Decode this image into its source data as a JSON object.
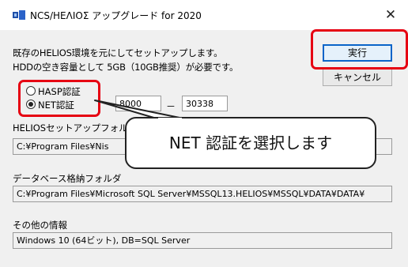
{
  "window": {
    "title": "NCS/HEΛIOΣ アップグレード for 2020",
    "close_glyph": "✕"
  },
  "description": {
    "line1": "既存のHELIOS環境を元にしてセットアップします。",
    "line2": "HDDの空き容量として 5GB（10GB推奨）が必要です。"
  },
  "buttons": {
    "execute": "実行",
    "cancel": "キャンセル"
  },
  "auth": {
    "hasp_label": "HASP認証",
    "net_label": "NET認証",
    "selected": "NET認証",
    "port_from": "8000",
    "port_separator": "－",
    "port_to": "30338"
  },
  "setup_folder": {
    "label": "HELIOSセットアップフォル",
    "value": "C:¥Program Files¥Nis"
  },
  "db_folder": {
    "label": "データベース格納フォルダ",
    "value": "C:¥Program Files¥Microsoft SQL Server¥MSSQL13.HELIOS¥MSSQL¥DATA¥DATA¥"
  },
  "other_info": {
    "label": "その他の情報",
    "value": "Windows 10 (64ビット), DB=SQL Server"
  },
  "annotation": {
    "callout_text": "NET 認証を選択します",
    "highlight_color": "#e60012"
  }
}
